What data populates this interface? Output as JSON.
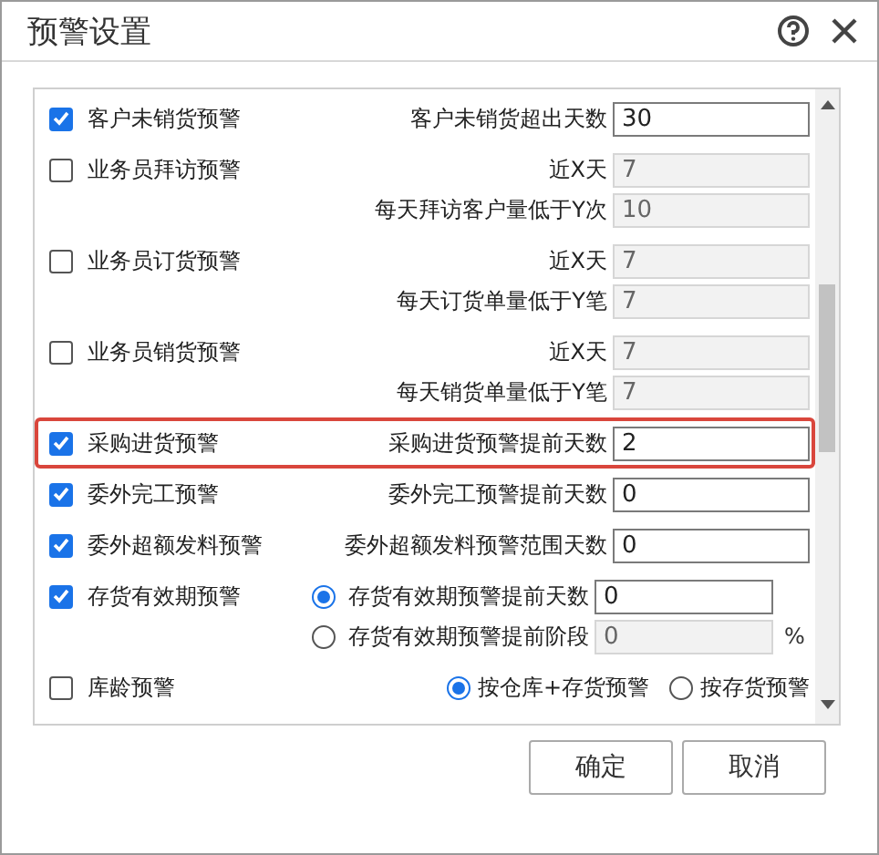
{
  "dialog": {
    "title": "预警设置"
  },
  "warnings": [
    {
      "label": "客户未销货预警",
      "checked": true,
      "highlighted": false,
      "fields": [
        {
          "kind": "input",
          "label": "客户未销货超出天数",
          "value": "30",
          "disabled": false
        }
      ]
    },
    {
      "label": "业务员拜访预警",
      "checked": false,
      "highlighted": false,
      "fields": [
        {
          "kind": "input",
          "label": "近X天",
          "value": "7",
          "disabled": true
        },
        {
          "kind": "input",
          "label": "每天拜访客户量低于Y次",
          "value": "10",
          "disabled": true
        }
      ]
    },
    {
      "label": "业务员订货预警",
      "checked": false,
      "highlighted": false,
      "fields": [
        {
          "kind": "input",
          "label": "近X天",
          "value": "7",
          "disabled": true
        },
        {
          "kind": "input",
          "label": "每天订货单量低于Y笔",
          "value": "7",
          "disabled": true
        }
      ]
    },
    {
      "label": "业务员销货预警",
      "checked": false,
      "highlighted": false,
      "fields": [
        {
          "kind": "input",
          "label": "近X天",
          "value": "7",
          "disabled": true
        },
        {
          "kind": "input",
          "label": "每天销货单量低于Y笔",
          "value": "7",
          "disabled": true
        }
      ]
    },
    {
      "label": "采购进货预警",
      "checked": true,
      "highlighted": true,
      "fields": [
        {
          "kind": "input",
          "label": "采购进货预警提前天数",
          "value": "2",
          "disabled": false
        }
      ]
    },
    {
      "label": "委外完工预警",
      "checked": true,
      "highlighted": false,
      "fields": [
        {
          "kind": "input",
          "label": "委外完工预警提前天数",
          "value": "0",
          "disabled": false
        }
      ]
    },
    {
      "label": "委外超额发料预警",
      "checked": true,
      "highlighted": false,
      "fields": [
        {
          "kind": "input",
          "label": "委外超额发料预警范围天数",
          "value": "0",
          "disabled": false
        }
      ]
    },
    {
      "label": "存货有效期预警",
      "checked": true,
      "highlighted": false,
      "fields": [
        {
          "kind": "radio_input",
          "label": "存货有效期预警提前天数",
          "value": "0",
          "disabled": false,
          "selected": true
        },
        {
          "kind": "radio_input",
          "label": "存货有效期预警提前阶段",
          "value": "0",
          "disabled": true,
          "selected": false,
          "unit": "%"
        }
      ]
    },
    {
      "label": "库龄预警",
      "checked": false,
      "highlighted": false,
      "fields": [
        {
          "kind": "radios",
          "options": [
            {
              "label": "按仓库+存货预警",
              "selected": true
            },
            {
              "label": "按存货预警",
              "selected": false
            }
          ]
        }
      ]
    }
  ],
  "buttons": [
    "确定",
    "取消"
  ]
}
